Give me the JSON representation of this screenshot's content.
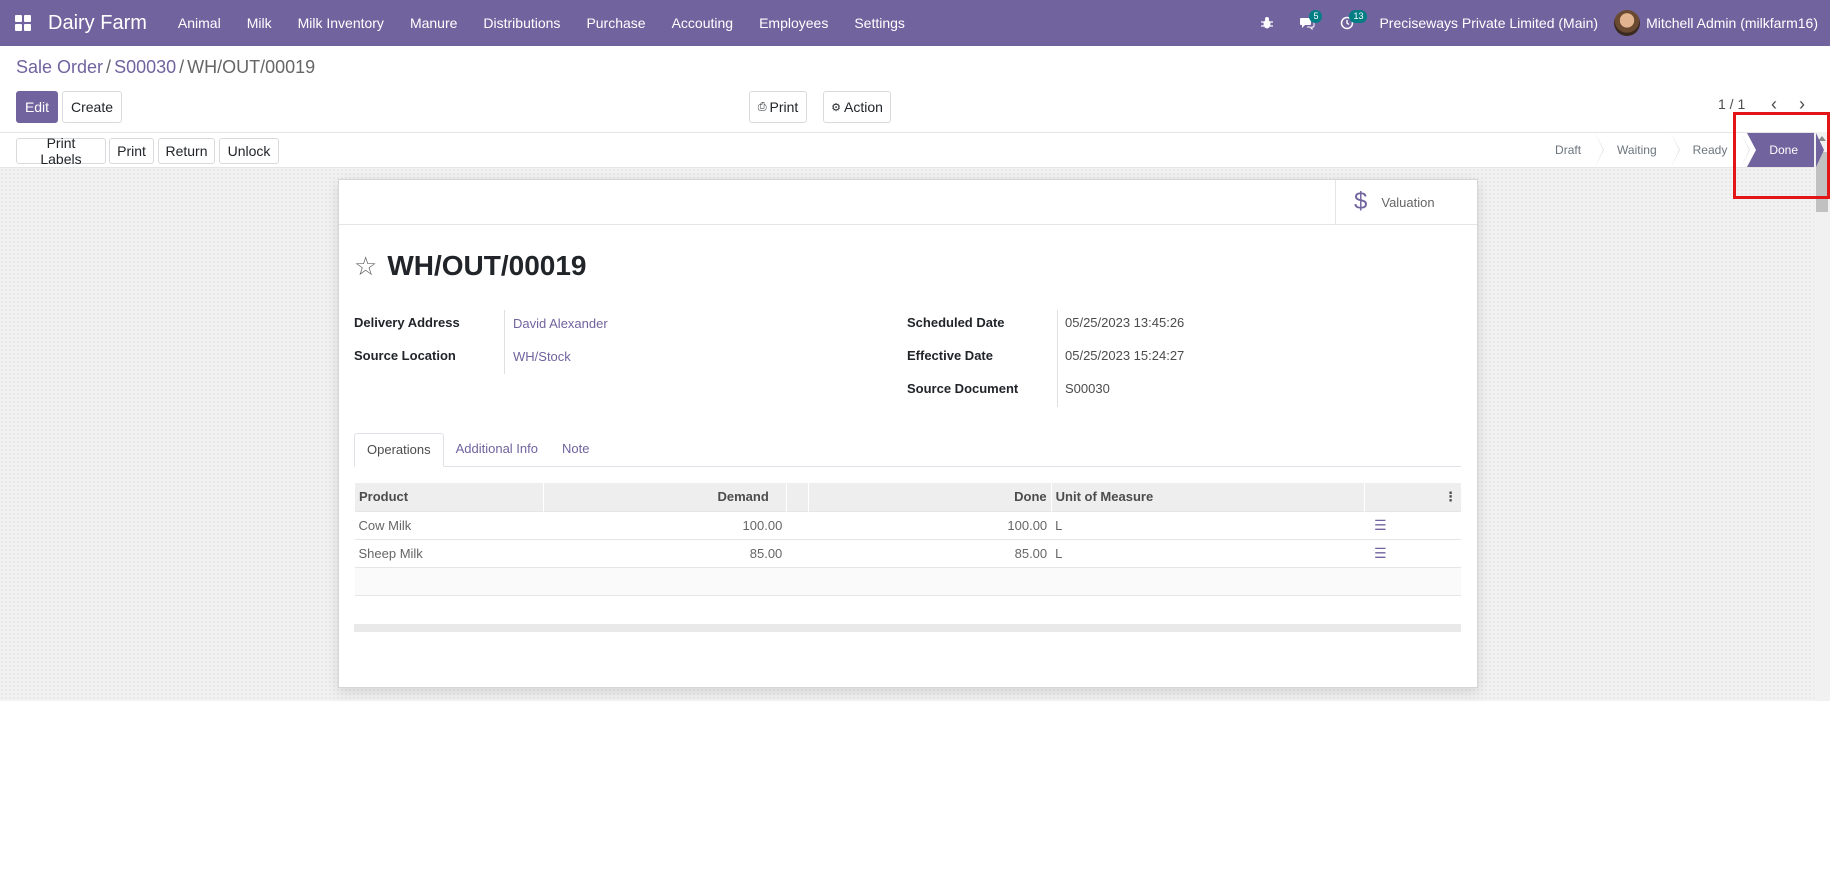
{
  "navbar": {
    "brand": "Dairy Farm",
    "menu": [
      "Animal",
      "Milk",
      "Milk Inventory",
      "Manure",
      "Distributions",
      "Purchase",
      "Accouting",
      "Employees",
      "Settings"
    ],
    "messages_badge": "5",
    "activity_badge": "13",
    "company": "Preciseways Private Limited (Main)",
    "user": "Mitchell Admin (milkfarm16)"
  },
  "breadcrumb": {
    "root": "Sale Order",
    "parent": "S00030",
    "current": "WH/OUT/00019"
  },
  "control": {
    "edit": "Edit",
    "create": "Create",
    "print": "Print",
    "action": "Action",
    "pager": "1 / 1"
  },
  "status_buttons": [
    "Print Labels",
    "Print",
    "Return",
    "Unlock"
  ],
  "stages": [
    "Draft",
    "Waiting",
    "Ready",
    "Done"
  ],
  "current_stage": "Done",
  "smart_button": {
    "label": "Valuation"
  },
  "record": {
    "name": "WH/OUT/00019",
    "left_fields": [
      {
        "label": "Delivery Address",
        "value": "David Alexander"
      },
      {
        "label": "Source Location",
        "value": "WH/Stock"
      }
    ],
    "right_fields": [
      {
        "label": "Scheduled Date",
        "value": "05/25/2023 13:45:26"
      },
      {
        "label": "Effective Date",
        "value": "05/25/2023 15:24:27"
      },
      {
        "label": "Source Document",
        "value": "S00030"
      }
    ]
  },
  "tabs": [
    "Operations",
    "Additional Info",
    "Note"
  ],
  "operations": {
    "columns": [
      "Product",
      "Demand",
      "Done",
      "Unit of Measure"
    ],
    "rows": [
      {
        "product": "Cow Milk",
        "demand": "100.00",
        "done": "100.00",
        "uom": "L"
      },
      {
        "product": "Sheep Milk",
        "demand": "85.00",
        "done": "85.00",
        "uom": "L"
      }
    ]
  },
  "colors": {
    "brand": "#71639e",
    "highlight": "#e21616"
  }
}
